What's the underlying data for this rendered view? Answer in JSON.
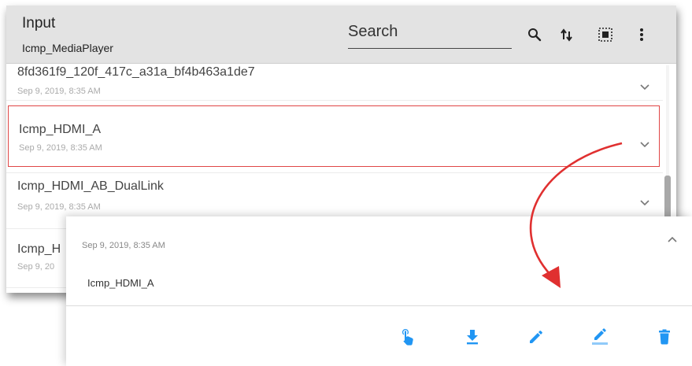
{
  "header": {
    "title": "Input",
    "subtitle": "Icmp_MediaPlayer",
    "search_placeholder": "Search",
    "icons": [
      "search-icon",
      "sort-icon",
      "select-all-icon",
      "more-vert-icon"
    ]
  },
  "list": {
    "items": [
      {
        "name": "8fd361f9_120f_417c_a31a_bf4b463a1de7",
        "date": "Sep 9, 2019, 8:35 AM"
      },
      {
        "name": "Icmp_HDMI_A",
        "date": "Sep 9, 2019, 8:35 AM",
        "selected": true
      },
      {
        "name": "Icmp_HDMI_AB_DualLink",
        "date": "Sep 9, 2019, 8:35 AM"
      },
      {
        "name": "Icmp_H",
        "date": "Sep 9, 20"
      }
    ]
  },
  "detail": {
    "date": "Sep 9, 2019, 8:35 AM",
    "name": "Icmp_HDMI_A",
    "actions": [
      "touch-icon",
      "download-icon",
      "edit-icon",
      "edit-underline-icon",
      "delete-icon"
    ]
  },
  "colors": {
    "header_bg": "#e3e3e3",
    "accent_blue": "#2196f3",
    "highlight_red": "#e03030"
  }
}
